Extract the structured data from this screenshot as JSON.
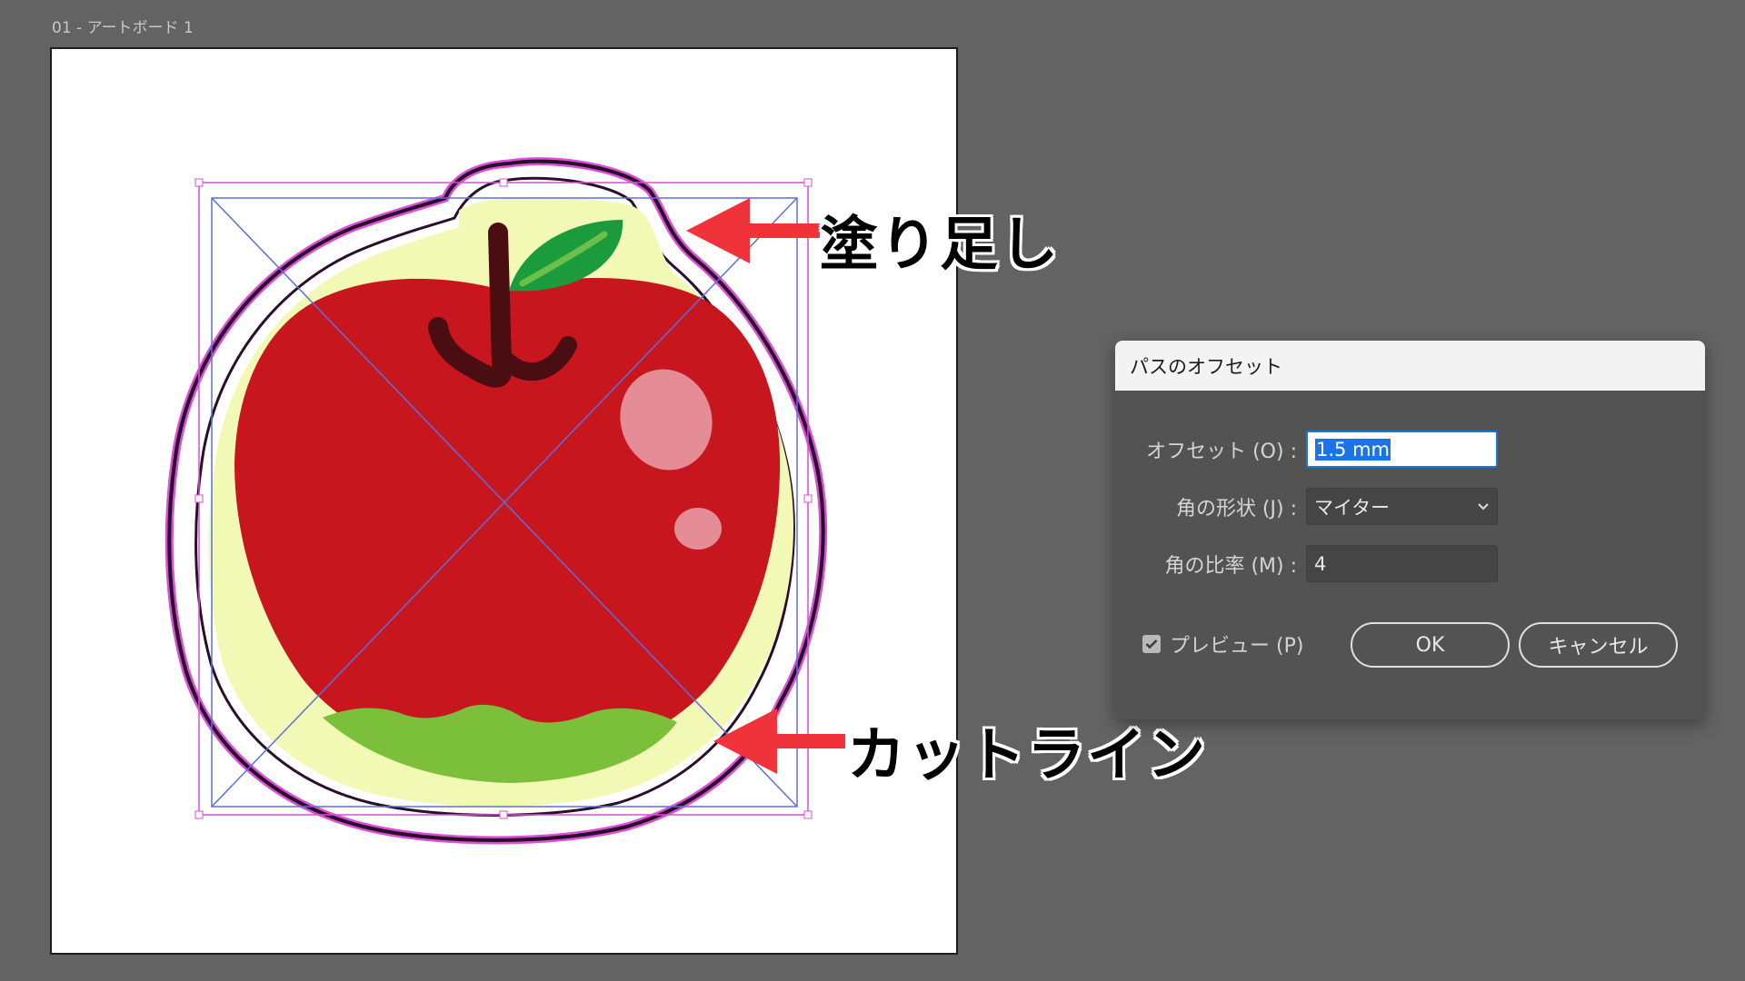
{
  "artboard": {
    "label": "01 - アートボード 1"
  },
  "annotations": {
    "bleed": "塗り足し",
    "cutline": "カットライン"
  },
  "dialog": {
    "title": "パスのオフセット",
    "offset": {
      "label": "オフセット (O) :",
      "value": "1.5 mm"
    },
    "corner": {
      "label": "角の形状 (J) :",
      "value": "マイター"
    },
    "miter_limit": {
      "label": "角の比率 (M) :",
      "value": "4"
    },
    "preview": {
      "label": "プレビュー (P)",
      "checked": true
    },
    "ok_label": "OK",
    "cancel_label": "キャンセル"
  },
  "colors": {
    "apple_red": "#c8161f",
    "bleed_fill": "#f1f9b5",
    "leaf_green": "#1c9b3c",
    "grass_green": "#7cbf3a",
    "stem": "#4a0d12",
    "cut_line": "#2a0f2a",
    "cut_outline": "#d94fd6",
    "selection": "#5d6ee0",
    "arrow": "#f0333a"
  }
}
